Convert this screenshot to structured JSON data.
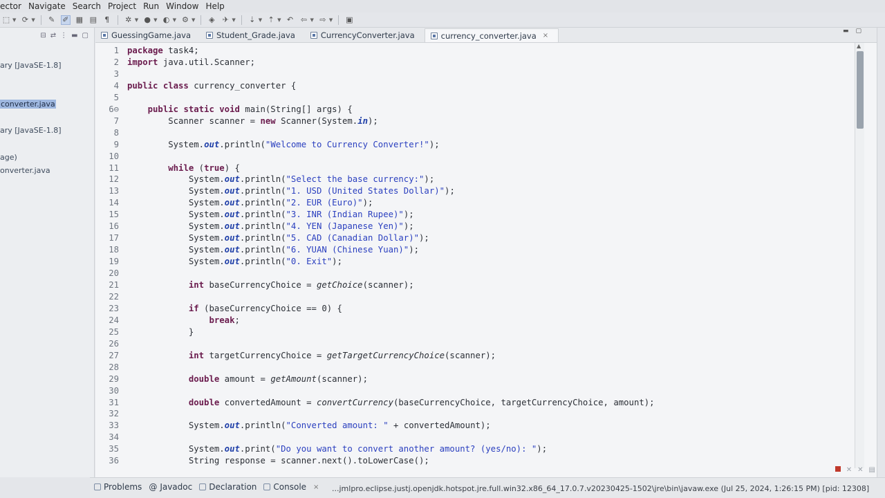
{
  "menu": [
    "ector",
    "Navigate",
    "Search",
    "Project",
    "Run",
    "Window",
    "Help"
  ],
  "explorer": {
    "items": [
      {
        "label": "ary [JavaSE-1.8]",
        "selected": false
      },
      {
        "label": "converter.java",
        "selected": true
      },
      {
        "label": "ary [JavaSE-1.8]",
        "selected": false
      },
      {
        "label": "age)",
        "selected": false
      },
      {
        "label": "onverter.java",
        "selected": false
      }
    ]
  },
  "tabs": [
    {
      "label": "GuessingGame.java",
      "active": false
    },
    {
      "label": "Student_Grade.java",
      "active": false
    },
    {
      "label": "CurrencyConverter.java",
      "active": false
    },
    {
      "label": "currency_converter.java",
      "active": true,
      "close": "×"
    }
  ],
  "code_lines": [
    {
      "n": "1",
      "tokens": [
        {
          "t": "package",
          "c": "kw"
        },
        {
          "t": " task4;"
        }
      ]
    },
    {
      "n": "2",
      "tokens": [
        {
          "t": "import",
          "c": "kw"
        },
        {
          "t": " java.util.Scanner;"
        }
      ]
    },
    {
      "n": "3",
      "tokens": []
    },
    {
      "n": "4",
      "tokens": [
        {
          "t": "public class",
          "c": "kw"
        },
        {
          "t": " currency_converter {"
        }
      ]
    },
    {
      "n": "5",
      "tokens": []
    },
    {
      "n": "6⊖",
      "tokens": [
        {
          "t": "    "
        },
        {
          "t": "public static void",
          "c": "kw"
        },
        {
          "t": " main(String[] args) {"
        }
      ]
    },
    {
      "n": "7",
      "tokens": [
        {
          "t": "        Scanner scanner = "
        },
        {
          "t": "new",
          "c": "kw"
        },
        {
          "t": " Scanner(System."
        },
        {
          "t": "in",
          "c": "fld"
        },
        {
          "t": ");"
        }
      ]
    },
    {
      "n": "8",
      "tokens": []
    },
    {
      "n": "9",
      "tokens": [
        {
          "t": "        System."
        },
        {
          "t": "out",
          "c": "fld"
        },
        {
          "t": ".println("
        },
        {
          "t": "\"Welcome to Currency Converter!\"",
          "c": "str"
        },
        {
          "t": ");"
        }
      ]
    },
    {
      "n": "10",
      "tokens": []
    },
    {
      "n": "11",
      "tokens": [
        {
          "t": "        "
        },
        {
          "t": "while",
          "c": "kw"
        },
        {
          "t": " ("
        },
        {
          "t": "true",
          "c": "kw"
        },
        {
          "t": ") {"
        }
      ]
    },
    {
      "n": "12",
      "tokens": [
        {
          "t": "            System."
        },
        {
          "t": "out",
          "c": "fld"
        },
        {
          "t": ".println("
        },
        {
          "t": "\"Select the base currency:\"",
          "c": "str"
        },
        {
          "t": ");"
        }
      ]
    },
    {
      "n": "13",
      "tokens": [
        {
          "t": "            System."
        },
        {
          "t": "out",
          "c": "fld"
        },
        {
          "t": ".println("
        },
        {
          "t": "\"1. USD (United States Dollar)\"",
          "c": "str"
        },
        {
          "t": ");"
        }
      ]
    },
    {
      "n": "14",
      "tokens": [
        {
          "t": "            System."
        },
        {
          "t": "out",
          "c": "fld"
        },
        {
          "t": ".println("
        },
        {
          "t": "\"2. EUR (Euro)\"",
          "c": "str"
        },
        {
          "t": ");"
        }
      ]
    },
    {
      "n": "15",
      "tokens": [
        {
          "t": "            System."
        },
        {
          "t": "out",
          "c": "fld"
        },
        {
          "t": ".println("
        },
        {
          "t": "\"3. INR (Indian Rupee)\"",
          "c": "str"
        },
        {
          "t": ");"
        }
      ]
    },
    {
      "n": "16",
      "tokens": [
        {
          "t": "            System."
        },
        {
          "t": "out",
          "c": "fld"
        },
        {
          "t": ".println("
        },
        {
          "t": "\"4. YEN (Japanese Yen)\"",
          "c": "str"
        },
        {
          "t": ");"
        }
      ]
    },
    {
      "n": "17",
      "tokens": [
        {
          "t": "            System."
        },
        {
          "t": "out",
          "c": "fld"
        },
        {
          "t": ".println("
        },
        {
          "t": "\"5. CAD (Canadian Dollar)\"",
          "c": "str"
        },
        {
          "t": ");"
        }
      ]
    },
    {
      "n": "18",
      "tokens": [
        {
          "t": "            System."
        },
        {
          "t": "out",
          "c": "fld"
        },
        {
          "t": ".println("
        },
        {
          "t": "\"6. YUAN (Chinese Yuan)\"",
          "c": "str"
        },
        {
          "t": ");"
        }
      ]
    },
    {
      "n": "19",
      "tokens": [
        {
          "t": "            System."
        },
        {
          "t": "out",
          "c": "fld"
        },
        {
          "t": ".println("
        },
        {
          "t": "\"0. Exit\"",
          "c": "str"
        },
        {
          "t": ");"
        }
      ]
    },
    {
      "n": "20",
      "tokens": []
    },
    {
      "n": "21",
      "tokens": [
        {
          "t": "            "
        },
        {
          "t": "int",
          "c": "kw"
        },
        {
          "t": " baseCurrencyChoice = "
        },
        {
          "t": "getChoice",
          "c": "mth"
        },
        {
          "t": "(scanner);"
        }
      ]
    },
    {
      "n": "22",
      "tokens": []
    },
    {
      "n": "23",
      "tokens": [
        {
          "t": "            "
        },
        {
          "t": "if",
          "c": "kw"
        },
        {
          "t": " (baseCurrencyChoice == 0) {"
        }
      ]
    },
    {
      "n": "24",
      "tokens": [
        {
          "t": "                "
        },
        {
          "t": "break",
          "c": "kw"
        },
        {
          "t": ";"
        }
      ]
    },
    {
      "n": "25",
      "tokens": [
        {
          "t": "            }"
        }
      ]
    },
    {
      "n": "26",
      "tokens": []
    },
    {
      "n": "27",
      "tokens": [
        {
          "t": "            "
        },
        {
          "t": "int",
          "c": "kw"
        },
        {
          "t": " targetCurrencyChoice = "
        },
        {
          "t": "getTargetCurrencyChoice",
          "c": "mth"
        },
        {
          "t": "(scanner);"
        }
      ]
    },
    {
      "n": "28",
      "tokens": []
    },
    {
      "n": "29",
      "tokens": [
        {
          "t": "            "
        },
        {
          "t": "double",
          "c": "kw"
        },
        {
          "t": " amount = "
        },
        {
          "t": "getAmount",
          "c": "mth"
        },
        {
          "t": "(scanner);"
        }
      ]
    },
    {
      "n": "30",
      "tokens": []
    },
    {
      "n": "31",
      "tokens": [
        {
          "t": "            "
        },
        {
          "t": "double",
          "c": "kw"
        },
        {
          "t": " convertedAmount = "
        },
        {
          "t": "convertCurrency",
          "c": "mth"
        },
        {
          "t": "(baseCurrencyChoice, targetCurrencyChoice, amount);"
        }
      ]
    },
    {
      "n": "32",
      "tokens": []
    },
    {
      "n": "33",
      "tokens": [
        {
          "t": "            System."
        },
        {
          "t": "out",
          "c": "fld"
        },
        {
          "t": ".println("
        },
        {
          "t": "\"Converted amount: \"",
          "c": "str"
        },
        {
          "t": " + convertedAmount);"
        }
      ]
    },
    {
      "n": "34",
      "tokens": []
    },
    {
      "n": "35",
      "tokens": [
        {
          "t": "            System."
        },
        {
          "t": "out",
          "c": "fld"
        },
        {
          "t": ".print("
        },
        {
          "t": "\"Do you want to convert another amount? (yes/no): \"",
          "c": "str"
        },
        {
          "t": ");"
        }
      ]
    },
    {
      "n": "36",
      "tokens": [
        {
          "t": "            String response = scanner.next().toLowerCase();"
        }
      ]
    }
  ],
  "bottom": {
    "tabs": [
      {
        "label": "Problems",
        "active": false
      },
      {
        "label": "Javadoc",
        "active": false
      },
      {
        "label": "Declaration",
        "active": false
      },
      {
        "label": "Console",
        "active": true,
        "close": "×"
      }
    ],
    "status": "...jmlpro.eclipse.justj.openjdk.hotspot.jre.full.win32.x86_64_17.0.7.v20230425-1502\\jre\\bin\\javaw.exe  (Jul 25, 2024, 1:26:15 PM) [pid: 12308]"
  },
  "colors": {
    "keyword": "#6a1b4d",
    "string": "#2a3fbf",
    "field": "#1f3fa8",
    "selection": "#9fb8e0"
  }
}
